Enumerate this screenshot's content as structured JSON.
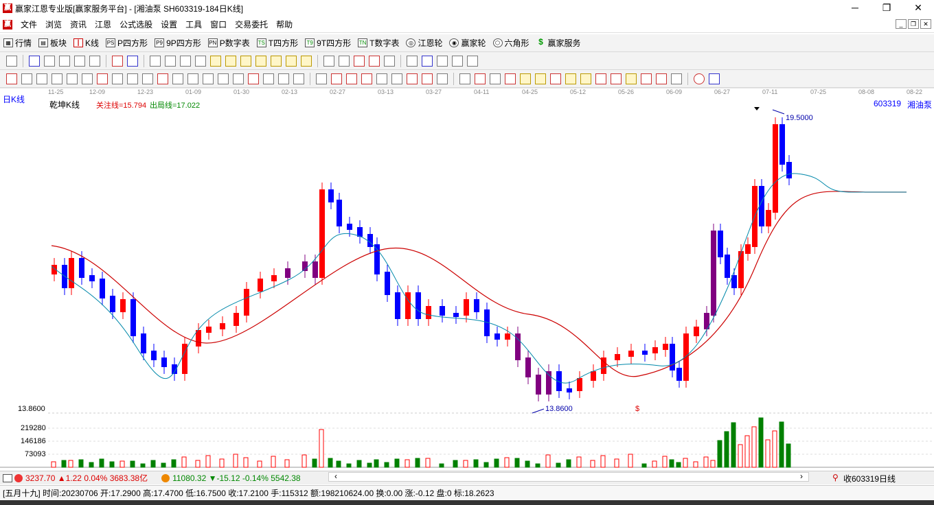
{
  "window": {
    "title": "赢家江恩专业版[赢家服务平台] - [湘油泵  SH603319-184日K线]",
    "minimize": "─",
    "restore": "❐",
    "close": "✕"
  },
  "menu": {
    "logo": "赢",
    "items": [
      "文件",
      "浏览",
      "资讯",
      "江恩",
      "公式选股",
      "设置",
      "工具",
      "窗口",
      "交易委托",
      "帮助"
    ]
  },
  "toolbar1": {
    "items": [
      {
        "label": "行情",
        "icon": "grid-icon"
      },
      {
        "label": "板块",
        "icon": "blocks-icon"
      },
      {
        "label": "K线",
        "icon": "candlestick-icon"
      },
      {
        "label": "P四方形",
        "icon": "ps-icon"
      },
      {
        "label": "9P四方形",
        "icon": "p9-icon"
      },
      {
        "label": "P数字表",
        "icon": "pn-icon"
      },
      {
        "label": "T四方形",
        "icon": "ts-icon"
      },
      {
        "label": "9T四方形",
        "icon": "t9-icon"
      },
      {
        "label": "T数字表",
        "icon": "tn-icon"
      },
      {
        "label": "江恩轮",
        "icon": "wheel-icon"
      },
      {
        "label": "赢家轮",
        "icon": "winner-wheel-icon"
      },
      {
        "label": "六角形",
        "icon": "hexagon-icon"
      },
      {
        "label": "赢家服务",
        "icon": "dollar-icon"
      }
    ]
  },
  "chart": {
    "period_label": "日K线",
    "indicator_name": "乾坤K线",
    "focus_line": "关注线=15.794",
    "exit_line": "出局线=17.022",
    "stock_code": "603319",
    "stock_name": "湘油泵",
    "high_label": "19.5000",
    "low_label": "13.8600",
    "price_axis_label": "13.8600",
    "dollar_mark": "$",
    "dates": [
      "11-25",
      "12-09",
      "12-23",
      "01-09",
      "01-30",
      "02-13",
      "02-27",
      "03-13",
      "03-27",
      "04-11",
      "04-25",
      "05-12",
      "05-26",
      "06-09",
      "06-27",
      "07-11",
      "07-25",
      "08-08",
      "08-22"
    ],
    "volume_labels": [
      "219280",
      "146186",
      "73093"
    ],
    "colors": {
      "up": "#ff0000",
      "down": "#0000ff",
      "ma_fast": "#0088aa",
      "ma_slow": "#cc0000",
      "purple": "#800080",
      "volume_up": "#ff0000",
      "volume_down": "#008000"
    }
  },
  "chart_data": {
    "type": "candlestick",
    "ylim": [
      13.86,
      19.5
    ],
    "high": 19.5,
    "low": 13.86,
    "last_bar": {
      "date": "20230706",
      "open": 17.29,
      "high": 17.47,
      "low": 16.75,
      "close": 17.21
    }
  },
  "status": {
    "sh_index": "3237.70",
    "sh_change": "▲1.22",
    "sh_pct": "0.04%",
    "sh_amount": "3683.38亿",
    "sz_index": "11080.32",
    "sz_change": "▼-15.12",
    "sz_pct": "-0.14%",
    "sz_amount": "5542.38",
    "fav": "收603319日线"
  },
  "info": {
    "text": "[五月十九] 时间:20230706 开:17.2900 高:17.4700 低:16.7500 收:17.2100 手:115312 额:198210624.00 换:0.00 涨:-0.12 盘:0 标:18.2623"
  }
}
